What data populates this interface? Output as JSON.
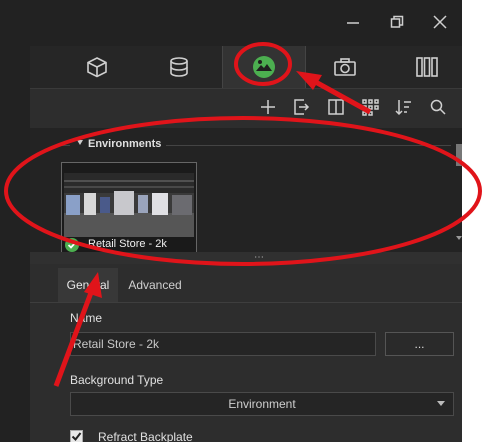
{
  "window": {
    "minimize_icon": "minimize-icon",
    "restore_icon": "restore-icon",
    "close_icon": "close-icon"
  },
  "tabs": [
    {
      "icon": "cube-icon"
    },
    {
      "icon": "material-ball-icon"
    },
    {
      "icon": "environment-icon",
      "active": true
    },
    {
      "icon": "camera-icon"
    },
    {
      "icon": "studio-icon"
    }
  ],
  "toolbar": {
    "icons": [
      "add-icon",
      "import-icon",
      "panel-layout-icon",
      "grid-view-icon",
      "sort-icon",
      "search-icon"
    ]
  },
  "library": {
    "section_title": "Environments",
    "items": [
      {
        "label": "Retail Store - 2k",
        "selected": true
      }
    ]
  },
  "splitter": {
    "handle": "⋯"
  },
  "properties": {
    "tabs": [
      {
        "label": "General",
        "active": true
      },
      {
        "label": "Advanced",
        "active": false
      }
    ],
    "name_label": "Name",
    "name_value": "Retail Store - 2k",
    "browse_label": "...",
    "bg_type_label": "Background Type",
    "bg_type_value": "Environment",
    "refract_label": "Refract Backplate",
    "refract_checked": true
  },
  "colors": {
    "accent_green": "#4caf50",
    "annotation_red": "#e0141a"
  }
}
